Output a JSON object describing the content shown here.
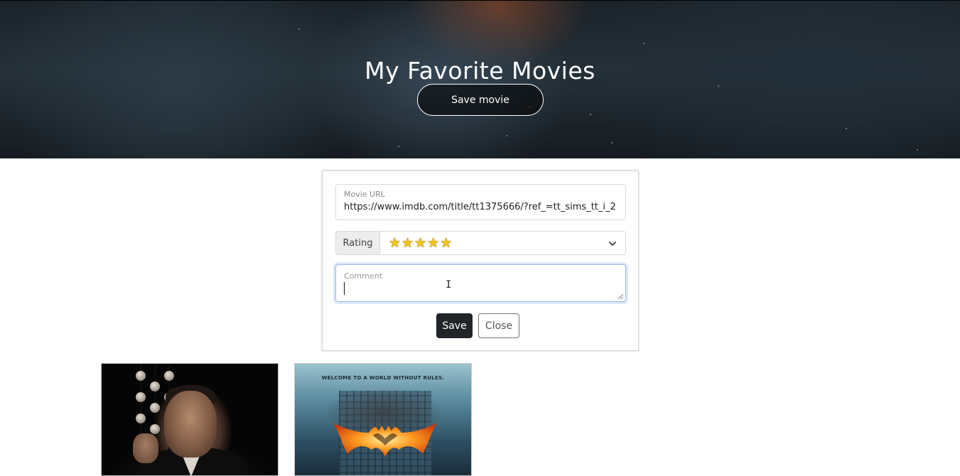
{
  "hero": {
    "title": "My Favorite Movies",
    "save_movie_button": "Save movie"
  },
  "form": {
    "url": {
      "label": "Movie URL",
      "value": "https://www.imdb.com/title/tt1375666/?ref_=tt_sims_tt_i_2"
    },
    "rating": {
      "label": "Rating",
      "selected_stars": 5,
      "selected_value": "★★★★★"
    },
    "comment": {
      "label": "Comment",
      "value": ""
    },
    "save_button": "Save",
    "close_button": "Close"
  },
  "movies": [
    {
      "poster": "godfather-poster"
    },
    {
      "poster": "dark-knight-poster",
      "tagline": "WELCOME TO A WORLD WITHOUT RULES."
    }
  ],
  "colors": {
    "star": "#f5c518",
    "primary_button": "#212529",
    "focus_border": "#9ab8e6"
  }
}
